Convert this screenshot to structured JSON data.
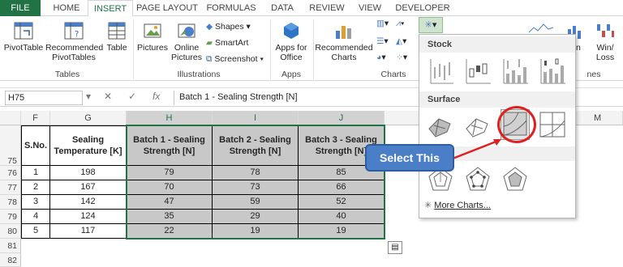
{
  "tabs": [
    "FILE",
    "HOME",
    "INSERT",
    "PAGE LAYOUT",
    "FORMULAS",
    "DATA",
    "REVIEW",
    "VIEW",
    "DEVELOPER"
  ],
  "ribbon": {
    "pivottable": "PivotTable",
    "recommended_pivot": "Recommended PivotTables",
    "table": "Table",
    "tables_group": "Tables",
    "pictures": "Pictures",
    "online_pictures": "Online Pictures",
    "shapes": "Shapes",
    "smartart": "SmartArt",
    "screenshot": "Screenshot",
    "illustrations_group": "Illustrations",
    "apps_for_office": "Apps for Office",
    "apps_group": "Apps",
    "recommended_charts": "Recommended Charts",
    "charts_group": "Charts",
    "sparkline_win_loss": "Win/ Loss",
    "sparkline_partial": "nn",
    "sparklines_partial": "nes"
  },
  "formula_bar": {
    "name_box": "H75",
    "content": "Batch 1 - Sealing Strength [N]"
  },
  "columns": [
    "F",
    "G",
    "H",
    "I",
    "J",
    "M"
  ],
  "rows": [
    "75",
    "76",
    "77",
    "78",
    "79",
    "80",
    "81",
    "82"
  ],
  "table": {
    "headers": [
      "S.No.",
      "Sealing Temperature [K]",
      "Batch 1 - Sealing Strength [N]",
      "Batch 2 - Sealing Strength [N]",
      "Batch 3 - Sealing Strength [N]"
    ],
    "rows": [
      [
        "1",
        "198",
        "79",
        "78",
        "85"
      ],
      [
        "2",
        "167",
        "70",
        "73",
        "66"
      ],
      [
        "3",
        "142",
        "47",
        "59",
        "52"
      ],
      [
        "4",
        "124",
        "35",
        "29",
        "40"
      ],
      [
        "5",
        "117",
        "22",
        "19",
        "19"
      ]
    ]
  },
  "dropdown": {
    "stock_label": "Stock",
    "surface_label": "Surface",
    "more_charts": "More Charts..."
  },
  "callout": "Select This",
  "colors": {
    "accent": "#217346",
    "callout": "#4a7ec7",
    "highlight_ring": "#e02020",
    "selection": "#c8c8c8"
  }
}
